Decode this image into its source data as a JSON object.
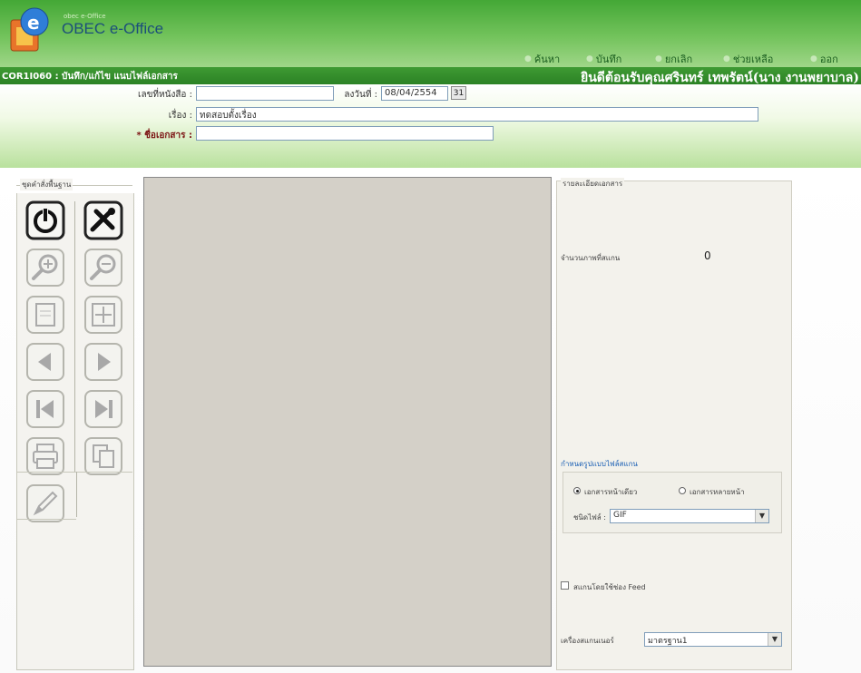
{
  "header": {
    "logo_subtitle": "obec e-Office",
    "app_title": "OBEC e-Office",
    "menu": [
      {
        "label": "ค้นหา"
      },
      {
        "label": "บันทึก"
      },
      {
        "label": "ยกเลิก"
      },
      {
        "label": "ช่วยเหลือ"
      },
      {
        "label": "ออก"
      }
    ]
  },
  "titlebar": {
    "page_title": "COR1I060 : บันทึก/แก้ไข แนบไฟล์เอกสาร",
    "welcome": "ยินดีต้อนรับคุณศรินทร์ เทพรัตน์(นาง งานพยาบาล)"
  },
  "form": {
    "doc_no_label": "เลขที่หนังสือ :",
    "doc_no_value": "",
    "date_label": "ลงวันที่ :",
    "date_value": "08/04/2554",
    "calendar_label": "31",
    "subject_label": "เรื่อง :",
    "subject_value": "ทดสอบตั้งเรื่อง",
    "docname_label": "* ชื่อเอกสาร :",
    "docname_value": ""
  },
  "toolbox": {
    "legend": "ชุดคำสั่งพื้นฐาน",
    "tools": [
      {
        "icon": "power-icon"
      },
      {
        "icon": "tools-icon"
      },
      {
        "icon": "zoom-in-icon"
      },
      {
        "icon": "zoom-out-icon"
      },
      {
        "icon": "fit-page-icon"
      },
      {
        "icon": "fit-width-icon"
      },
      {
        "icon": "previous-icon"
      },
      {
        "icon": "next-icon"
      },
      {
        "icon": "first-page-icon"
      },
      {
        "icon": "last-page-icon"
      },
      {
        "icon": "print-icon"
      },
      {
        "icon": "copy-icon"
      },
      {
        "icon": "pen-icon"
      }
    ]
  },
  "panel": {
    "legend": "รายละเอียดเอกสาร",
    "page_count_label": "จำนวนภาพที่สแกน",
    "page_count_value": "0",
    "format_title": "กำหนดรูปแบบไฟล์สแกน",
    "radio_single": "เอกสารหน้าเดียว",
    "radio_multi": "เอกสารหลายหน้า",
    "filetype_label": "ชนิดไฟล์ :",
    "filetype_value": "GIF",
    "feeder_label": "สแกนโดยใช้ช่อง Feed",
    "scanner_label": "เครื่องสแกนเนอร์",
    "scanner_value": "มาตรฐาน1"
  },
  "colors": {
    "header_green": "#44a836",
    "bar_green": "#2c8225",
    "viewer_gray": "#d4d0c8"
  }
}
